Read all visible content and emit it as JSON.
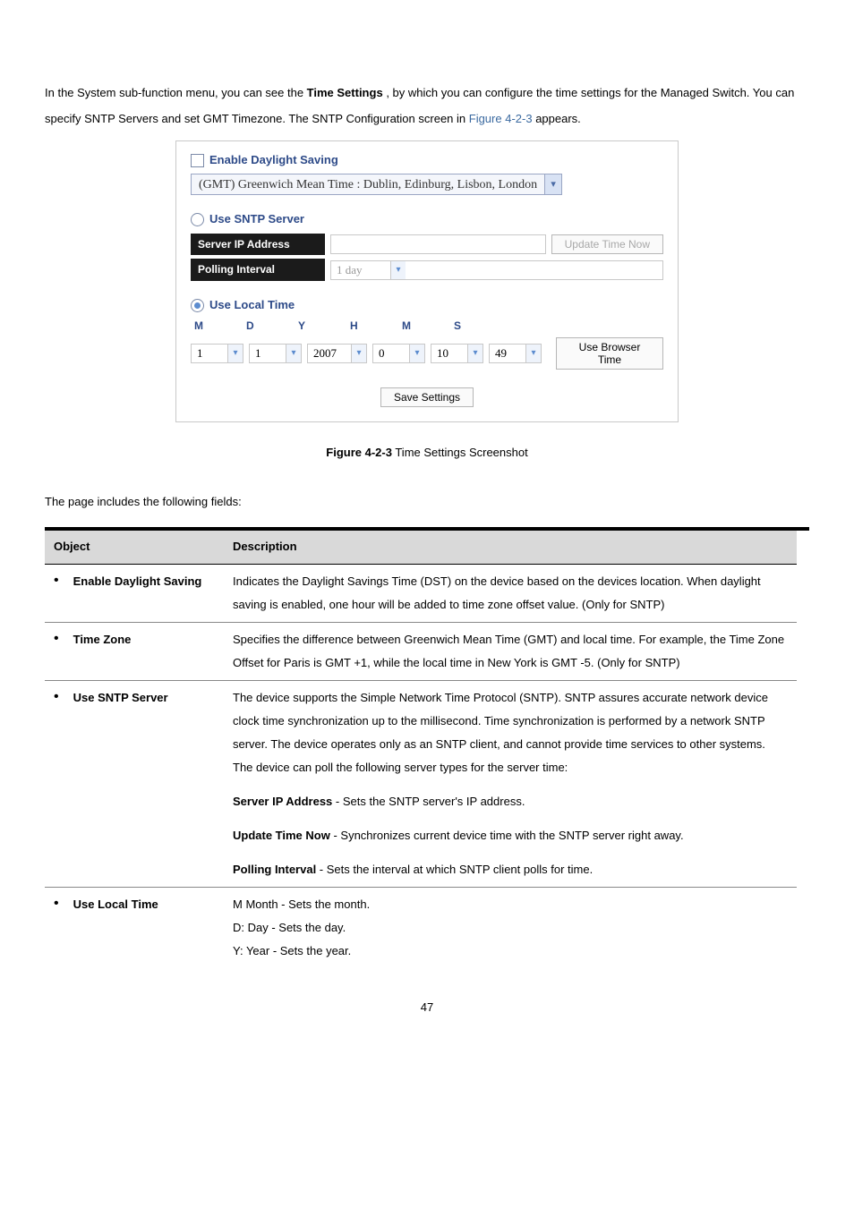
{
  "intro": {
    "pre": "In the System sub-function menu, you can see the ",
    "bold_item": "Time Settings",
    "mid": ", by which you can configure the time settings for the Managed Switch. You can specify SNTP Servers and set GMT Timezone. The SNTP Configuration screen in ",
    "figref": "Figure 4-2-3",
    "post": " appears."
  },
  "shot": {
    "enable_daylight": "Enable Daylight Saving",
    "timezone": "(GMT) Greenwich Mean Time : Dublin, Edinburg, Lisbon, London",
    "use_sntp": "Use SNTP Server",
    "server_ip_label": "Server IP Address",
    "update_now": "Update Time Now",
    "polling_label": "Polling Interval",
    "polling_value": "1 day",
    "use_local": "Use Local Time",
    "letters": {
      "m1": "M",
      "d": "D",
      "y": "Y",
      "h": "H",
      "m2": "M",
      "s": "S"
    },
    "vals": {
      "month": "1",
      "day": "1",
      "year": "2007",
      "hour": "0",
      "min": "10",
      "sec": "49"
    },
    "use_browser": "Use Browser Time",
    "save": "Save Settings"
  },
  "caption": {
    "b": "Figure 4-2-3",
    "rest": " Time Settings Screenshot"
  },
  "fields_intro": "The page includes the following fields:",
  "headers": {
    "object": "Object",
    "description": "Description"
  },
  "rows": {
    "eds": {
      "label": "Enable Daylight Saving",
      "desc": "Indicates the Daylight Savings Time (DST) on the device based on the devices location. When daylight saving is enabled, one hour will be added to time zone offset value. (Only for SNTP)"
    },
    "tz": {
      "label": "Time Zone",
      "desc": "Specifies the difference between Greenwich Mean Time (GMT) and local time. For example, the Time Zone Offset for Paris is GMT +1, while the local time in New York is GMT -5. (Only for SNTP)"
    },
    "sntp": {
      "label": "Use SNTP Server",
      "desc": "The device supports the Simple Network Time Protocol (SNTP). SNTP assures accurate network device clock time synchronization up to the millisecond. Time synchronization is performed by a network SNTP server. The device operates only as an SNTP client, and cannot provide time services to other systems. The device can poll the following server types for the server time:",
      "sub1_t": "Server IP Address",
      "sub1_d": " - Sets the SNTP server's IP address.",
      "sub2_t": "Update Time Now",
      "sub2_d": " - Synchronizes current device time with the SNTP server right away.",
      "sub3_t": "Polling Interval",
      "sub3_d": " - Sets the interval at which SNTP client polls for time."
    },
    "local": {
      "label": "Use Local Time",
      "l1": "M  Month - Sets the month.",
      "l2": "D: Day - Sets the day.",
      "l3": "Y: Year - Sets the year."
    }
  },
  "pgnum": "47"
}
